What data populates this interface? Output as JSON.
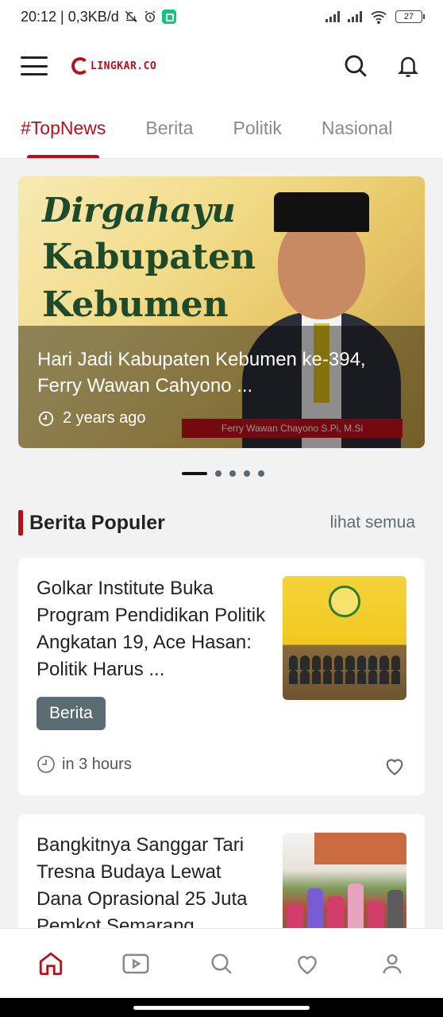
{
  "status_bar": {
    "time_speed": "20:12 | 0,3KB/d",
    "battery": "27"
  },
  "header": {
    "logo_text": "LINGKAR.CO",
    "icons": [
      "menu-icon",
      "search-icon",
      "bell-icon"
    ]
  },
  "tabs": [
    {
      "label": "#TopNews",
      "active": true
    },
    {
      "label": "Berita",
      "active": false
    },
    {
      "label": "Politik",
      "active": false
    },
    {
      "label": "Nasional",
      "active": false
    }
  ],
  "carousel": {
    "banner_line1": "Dirgahayu",
    "banner_line2": "Kabupaten",
    "banner_line3": "Kebumen",
    "name_strip": "Ferry Wawan Chayono S.Pi, M.Si",
    "title": "Hari Jadi Kabupaten Kebumen ke-394, Ferry Wawan Cahyono ...",
    "time": "2 years ago",
    "dots_total": 5,
    "active_dot": 1
  },
  "section": {
    "title": "Berita Populer",
    "see_all": "lihat semua"
  },
  "articles": [
    {
      "title": "Golkar Institute Buka Program Pendidikan Politik Angkatan 19, Ace Hasan: Politik Harus ...",
      "category": "Berita",
      "time": "in 3 hours"
    },
    {
      "title": "Bangkitnya Sanggar Tari Tresna Budaya Lewat Dana Oprasional 25 Juta Pemkot Semarang",
      "category": "",
      "time": ""
    }
  ],
  "bottom_nav": [
    "home-icon",
    "video-icon",
    "search-icon",
    "heart-icon",
    "profile-icon"
  ],
  "colors": {
    "accent": "#b3121b",
    "badge": "#5b6b74",
    "background": "#f2f2f2"
  }
}
